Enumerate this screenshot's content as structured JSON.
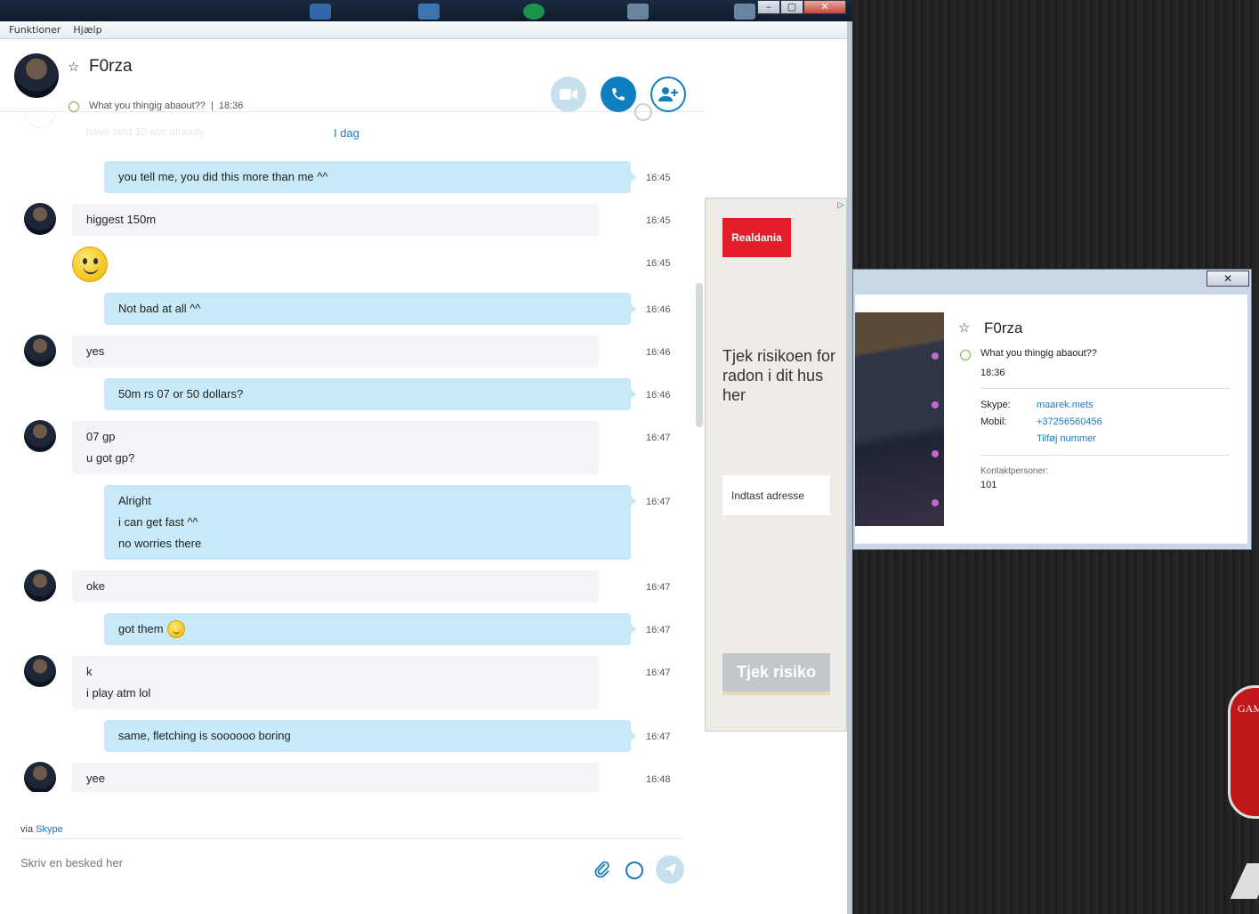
{
  "menu": {
    "items": [
      "Funktioner",
      "Hjælp"
    ]
  },
  "header": {
    "name": "F0rza",
    "mood": "What you thingig abaout??",
    "separator": "|",
    "time": "18:36"
  },
  "chat": {
    "faded_message": "have sold 10 acc already",
    "day_label": "I dag",
    "messages": [
      {
        "dir": "out",
        "lines": [
          "you tell me, you did this more than me ^^"
        ],
        "time": "16:45"
      },
      {
        "dir": "in",
        "lines": [
          "higgest 150m"
        ],
        "time": "16:45"
      },
      {
        "dir": "in-emoji",
        "lines": [],
        "time": "16:45"
      },
      {
        "dir": "out",
        "lines": [
          "Not bad at all ^^"
        ],
        "time": "16:46"
      },
      {
        "dir": "in",
        "lines": [
          "yes"
        ],
        "time": "16:46"
      },
      {
        "dir": "out",
        "lines": [
          "50m rs 07 or 50 dollars?"
        ],
        "time": "16:46"
      },
      {
        "dir": "in",
        "lines": [
          "07 gp",
          "u got gp?"
        ],
        "time": "16:47"
      },
      {
        "dir": "out",
        "lines": [
          "Alright",
          "i can get fast ^^",
          "no worries there"
        ],
        "time": "16:47"
      },
      {
        "dir": "in",
        "lines": [
          "oke"
        ],
        "time": "16:47"
      },
      {
        "dir": "out",
        "lines": [
          "got them"
        ],
        "time": "16:47"
      },
      {
        "dir": "in",
        "lines": [
          "k",
          "i play atm lol"
        ],
        "time": "16:47"
      },
      {
        "dir": "out",
        "lines": [
          "same, fletching is soooooo boring"
        ],
        "time": "16:47"
      },
      {
        "dir": "in",
        "lines": [
          "yee"
        ],
        "time": "16:48"
      }
    ]
  },
  "footer": {
    "via_prefix": "via",
    "via_link": "Skype",
    "input_placeholder": "Skriv en besked her"
  },
  "ad": {
    "logo": "Realdania",
    "text": "Tjek risikoen for radon i dit hus her",
    "input_placeholder": "Indtast adresse",
    "button": "Tjek risiko"
  },
  "profile": {
    "close": "✕",
    "name": "F0rza",
    "mood": "What you thingig abaout??",
    "time": "18:36",
    "skype_label": "Skype:",
    "skype_value": "maarek.mets",
    "mobile_label": "Mobil:",
    "mobile_value": "+37256560456",
    "add_number": "Tilføj nummer",
    "contacts_label": "Kontaktpersoner:",
    "contacts_value": "101"
  },
  "window_controls": {
    "min": "–",
    "max": "▢",
    "close": "✕"
  },
  "desktop": {
    "gaming_text": "GAM"
  },
  "colors": {
    "accent": "#0f7fc0",
    "bubble_out": "#c7e9f8",
    "bubble_in": "#f2f4f7",
    "online": "#7bb23a"
  }
}
